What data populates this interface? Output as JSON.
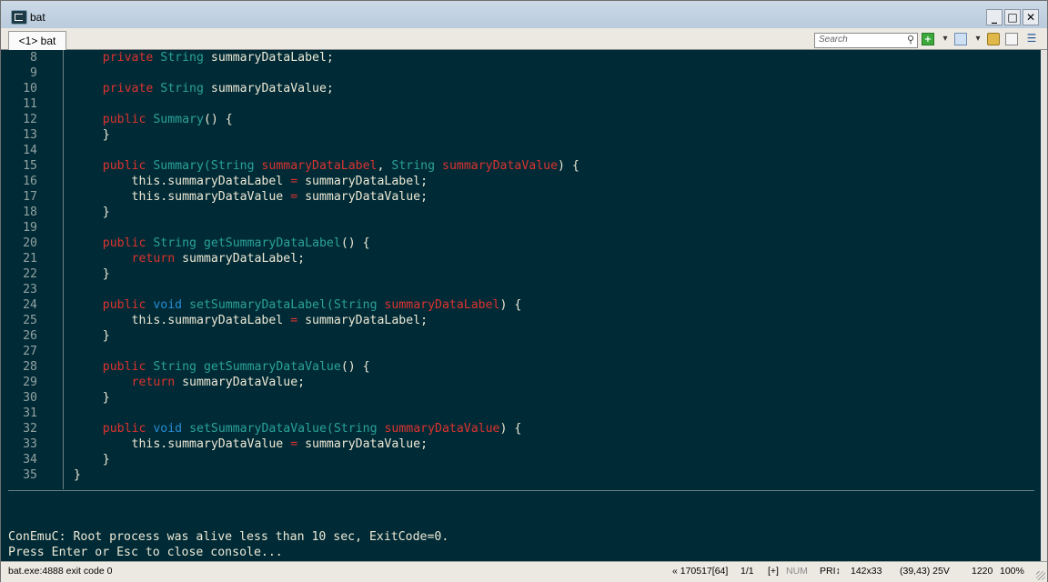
{
  "window": {
    "title": "bat"
  },
  "tab": {
    "label": "<1> bat"
  },
  "search": {
    "placeholder": "Search"
  },
  "code_lines": [
    {
      "n": "8",
      "tokens": [
        [
          "",
          "    "
        ],
        [
          "kw",
          "private"
        ],
        [
          "",
          " "
        ],
        [
          "ty",
          "String"
        ],
        [
          "",
          " summaryDataLabel;"
        ]
      ]
    },
    {
      "n": "9",
      "tokens": []
    },
    {
      "n": "10",
      "tokens": [
        [
          "",
          "    "
        ],
        [
          "kw",
          "private"
        ],
        [
          "",
          " "
        ],
        [
          "ty",
          "String"
        ],
        [
          "",
          " summaryDataValue;"
        ]
      ]
    },
    {
      "n": "11",
      "tokens": []
    },
    {
      "n": "12",
      "tokens": [
        [
          "",
          "    "
        ],
        [
          "kw",
          "public"
        ],
        [
          "",
          " "
        ],
        [
          "ty",
          "Summary"
        ],
        [
          "",
          "() {"
        ]
      ]
    },
    {
      "n": "13",
      "tokens": [
        [
          "",
          "    }"
        ]
      ]
    },
    {
      "n": "14",
      "tokens": []
    },
    {
      "n": "15",
      "tokens": [
        [
          "",
          "    "
        ],
        [
          "kw",
          "public"
        ],
        [
          "",
          " "
        ],
        [
          "ty",
          "Summary(String"
        ],
        [
          "",
          " "
        ],
        [
          "pr",
          "summaryDataLabel"
        ],
        [
          "",
          ", "
        ],
        [
          "ty",
          "String"
        ],
        [
          "",
          " "
        ],
        [
          "pr",
          "summaryDataValue"
        ],
        [
          "",
          ") {"
        ]
      ]
    },
    {
      "n": "16",
      "tokens": [
        [
          "",
          "        this.summaryDataLabel "
        ],
        [
          "kw",
          "="
        ],
        [
          "",
          " summaryDataLabel;"
        ]
      ]
    },
    {
      "n": "17",
      "tokens": [
        [
          "",
          "        this.summaryDataValue "
        ],
        [
          "kw",
          "="
        ],
        [
          "",
          " summaryDataValue;"
        ]
      ]
    },
    {
      "n": "18",
      "tokens": [
        [
          "",
          "    }"
        ]
      ]
    },
    {
      "n": "19",
      "tokens": []
    },
    {
      "n": "20",
      "tokens": [
        [
          "",
          "    "
        ],
        [
          "kw",
          "public"
        ],
        [
          "",
          " "
        ],
        [
          "ty",
          "String"
        ],
        [
          "",
          " "
        ],
        [
          "ty",
          "getSummaryDataLabel"
        ],
        [
          "",
          "() {"
        ]
      ]
    },
    {
      "n": "21",
      "tokens": [
        [
          "",
          "        "
        ],
        [
          "kw",
          "return"
        ],
        [
          "",
          " summaryDataLabel;"
        ]
      ]
    },
    {
      "n": "22",
      "tokens": [
        [
          "",
          "    }"
        ]
      ]
    },
    {
      "n": "23",
      "tokens": []
    },
    {
      "n": "24",
      "tokens": [
        [
          "",
          "    "
        ],
        [
          "kw",
          "public"
        ],
        [
          "",
          " "
        ],
        [
          "fn",
          "void"
        ],
        [
          "",
          " "
        ],
        [
          "ty",
          "setSummaryDataLabel(String"
        ],
        [
          "",
          " "
        ],
        [
          "pr",
          "summaryDataLabel"
        ],
        [
          "",
          ") {"
        ]
      ]
    },
    {
      "n": "25",
      "tokens": [
        [
          "",
          "        this.summaryDataLabel "
        ],
        [
          "kw",
          "="
        ],
        [
          "",
          " summaryDataLabel;"
        ]
      ]
    },
    {
      "n": "26",
      "tokens": [
        [
          "",
          "    }"
        ]
      ]
    },
    {
      "n": "27",
      "tokens": []
    },
    {
      "n": "28",
      "tokens": [
        [
          "",
          "    "
        ],
        [
          "kw",
          "public"
        ],
        [
          "",
          " "
        ],
        [
          "ty",
          "String"
        ],
        [
          "",
          " "
        ],
        [
          "ty",
          "getSummaryDataValue"
        ],
        [
          "",
          "() {"
        ]
      ]
    },
    {
      "n": "29",
      "tokens": [
        [
          "",
          "        "
        ],
        [
          "kw",
          "return"
        ],
        [
          "",
          " summaryDataValue;"
        ]
      ]
    },
    {
      "n": "30",
      "tokens": [
        [
          "",
          "    }"
        ]
      ]
    },
    {
      "n": "31",
      "tokens": []
    },
    {
      "n": "32",
      "tokens": [
        [
          "",
          "    "
        ],
        [
          "kw",
          "public"
        ],
        [
          "",
          " "
        ],
        [
          "fn",
          "void"
        ],
        [
          "",
          " "
        ],
        [
          "ty",
          "setSummaryDataValue(String"
        ],
        [
          "",
          " "
        ],
        [
          "pr",
          "summaryDataValue"
        ],
        [
          "",
          ") {"
        ]
      ]
    },
    {
      "n": "33",
      "tokens": [
        [
          "",
          "        this.summaryDataValue "
        ],
        [
          "kw",
          "="
        ],
        [
          "",
          " summaryDataValue;"
        ]
      ]
    },
    {
      "n": "34",
      "tokens": [
        [
          "",
          "    }"
        ]
      ]
    },
    {
      "n": "35",
      "tokens": [
        [
          "",
          "}"
        ]
      ]
    }
  ],
  "console_messages": [
    "ConEmuC: Root process was alive less than 10 sec, ExitCode=0.",
    "Press Enter or Esc to close console..."
  ],
  "status": {
    "left": "bat.exe:4888 exit code 0",
    "version": "« 170517[64]",
    "console_index": "1/1",
    "plus": "[+]",
    "num": "NUM",
    "pri": "PRI↕",
    "size": "142x33",
    "cursor": "(39,43) 25V",
    "buffer": "1220",
    "zoom": "100%"
  },
  "colors": {
    "console_bg": "#002b36",
    "keyword": "#dc322f",
    "type": "#2aa198",
    "void": "#268bd2",
    "text": "#eee8d5"
  }
}
